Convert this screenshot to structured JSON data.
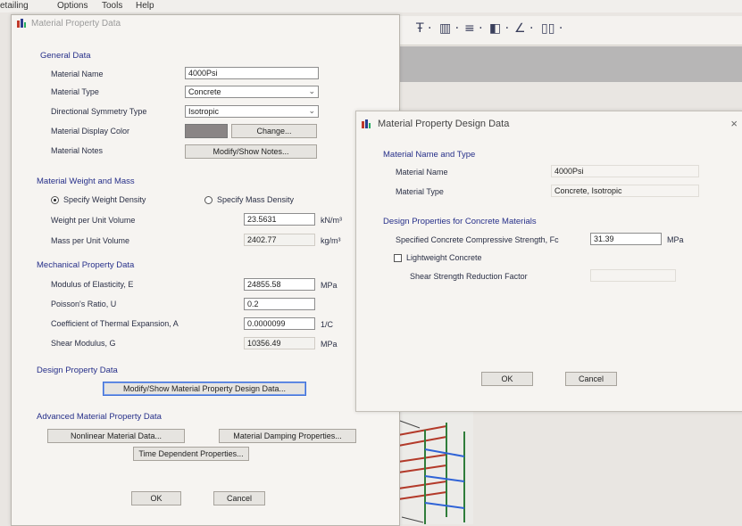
{
  "menubar": {
    "items": [
      "etailing",
      "Options",
      "Tools",
      "Help"
    ]
  },
  "toolbar": {
    "glyphs": [
      "Ŧ ·",
      "▥ ·",
      "≡ ·",
      "◧ ·",
      "∠ ·",
      "▯▯ ·"
    ]
  },
  "material_property_data": {
    "title": "Material Property Data",
    "general": {
      "heading": "General Data",
      "name_label": "Material Name",
      "name_value": "4000Psi",
      "type_label": "Material Type",
      "type_value": "Concrete",
      "symmetry_label": "Directional Symmetry Type",
      "symmetry_value": "Isotropic",
      "color_label": "Material Display Color",
      "change_button": "Change...",
      "notes_label": "Material Notes",
      "notes_button": "Modify/Show Notes..."
    },
    "weight_mass": {
      "heading": "Material Weight and Mass",
      "radio_weight": "Specify Weight Density",
      "radio_mass": "Specify Mass Density",
      "weight_label": "Weight per Unit Volume",
      "weight_value": "23.5631",
      "weight_unit": "kN/m³",
      "mass_label": "Mass per Unit Volume",
      "mass_value": "2402.77",
      "mass_unit": "kg/m³"
    },
    "mechanical": {
      "heading": "Mechanical Property Data",
      "e_label": "Modulus of Elasticity,  E",
      "e_value": "24855.58",
      "e_unit": "MPa",
      "u_label": "Poisson's Ratio,  U",
      "u_value": "0.2",
      "a_label": "Coefficient of Thermal Expansion,  A",
      "a_value": "0.0000099",
      "a_unit": "1/C",
      "g_label": "Shear Modulus,  G",
      "g_value": "10356.49",
      "g_unit": "MPa"
    },
    "design": {
      "heading": "Design Property Data",
      "button": "Modify/Show Material Property Design Data..."
    },
    "advanced": {
      "heading": "Advanced Material Property Data",
      "nonlinear_button": "Nonlinear Material Data...",
      "damping_button": "Material Damping Properties...",
      "time_button": "Time Dependent Properties..."
    },
    "ok": "OK",
    "cancel": "Cancel"
  },
  "design_data": {
    "title": "Material Property Design Data",
    "close": "×",
    "name_type_heading": "Material Name and Type",
    "name_label": "Material Name",
    "name_value": "4000Psi",
    "type_label": "Material Type",
    "type_value": "Concrete, Isotropic",
    "concrete_heading": "Design Properties for Concrete Materials",
    "fc_label": "Specified Concrete Compressive Strength, Fc",
    "fc_value": "31.39",
    "fc_unit": "MPa",
    "lightweight_label": "Lightweight Concrete",
    "shear_factor_label": "Shear Strength Reduction Factor",
    "ok": "OK",
    "cancel": "Cancel"
  }
}
